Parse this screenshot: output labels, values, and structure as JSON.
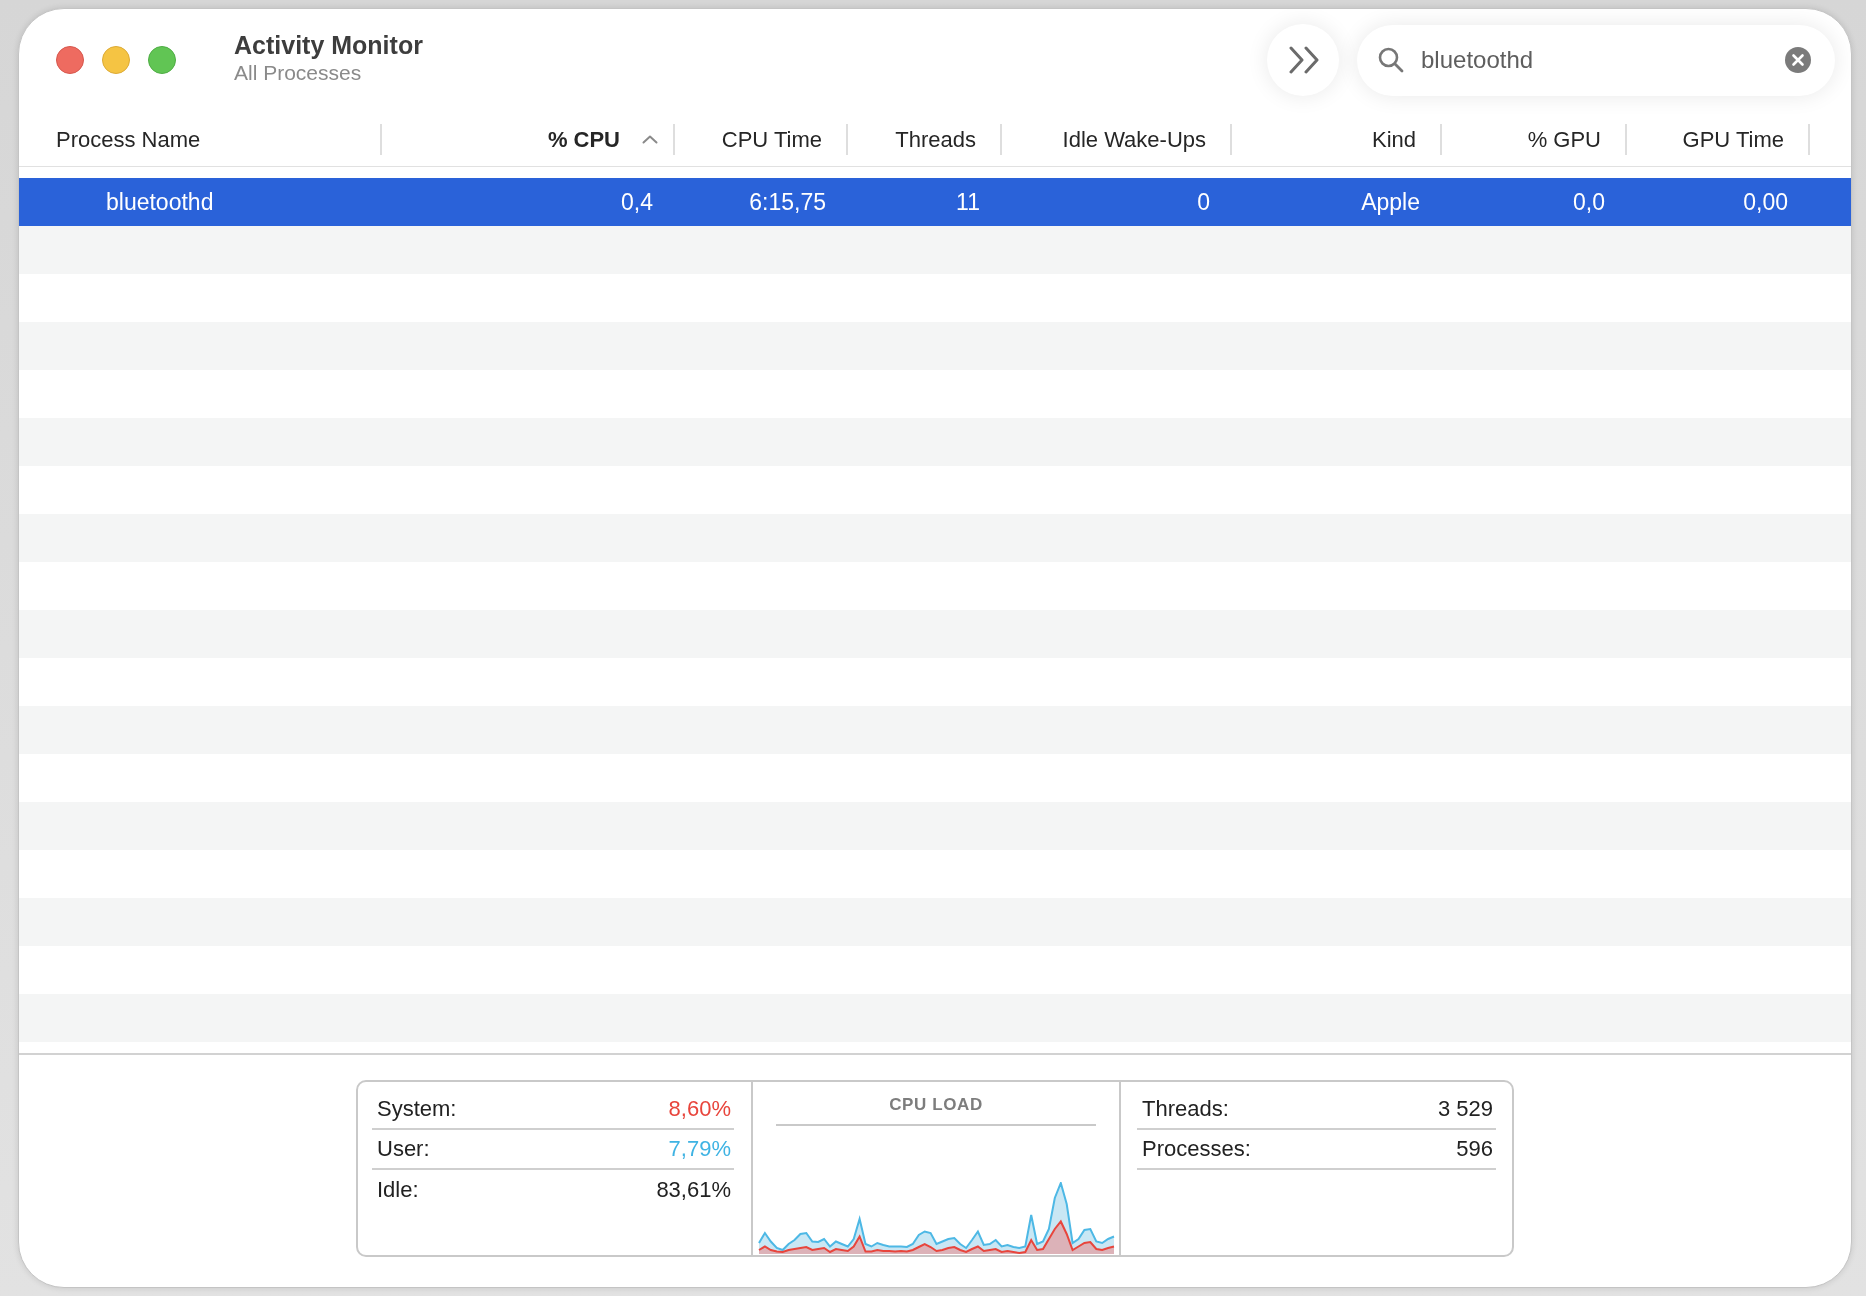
{
  "window": {
    "title": "Activity Monitor",
    "subtitle": "All Processes"
  },
  "toolbar": {
    "search": {
      "value": "bluetoothd"
    }
  },
  "table": {
    "columns": [
      {
        "label": "Process Name",
        "sorted": false
      },
      {
        "label": "% CPU",
        "sorted": true
      },
      {
        "label": "CPU Time",
        "sorted": false
      },
      {
        "label": "Threads",
        "sorted": false
      },
      {
        "label": "Idle Wake-Ups",
        "sorted": false
      },
      {
        "label": "Kind",
        "sorted": false
      },
      {
        "label": "% GPU",
        "sorted": false
      },
      {
        "label": "GPU Time",
        "sorted": false
      }
    ],
    "rows": [
      {
        "selected": true,
        "cells": [
          "bluetoothd",
          "0,4",
          "6:15,75",
          "11",
          "0",
          "Apple",
          "0,0",
          "0,00"
        ]
      }
    ]
  },
  "summary": {
    "cpu": [
      {
        "label": "System:",
        "value": "8,60%",
        "color": "#e8453c"
      },
      {
        "label": "User:",
        "value": "7,79%",
        "color": "#3fb3e3"
      },
      {
        "label": "Idle:",
        "value": "83,61%",
        "color": "#222222"
      }
    ],
    "chart": {
      "title": "CPU LOAD"
    },
    "counts": [
      {
        "label": "Threads:",
        "value": "3 529"
      },
      {
        "label": "Processes:",
        "value": "596"
      }
    ]
  }
}
